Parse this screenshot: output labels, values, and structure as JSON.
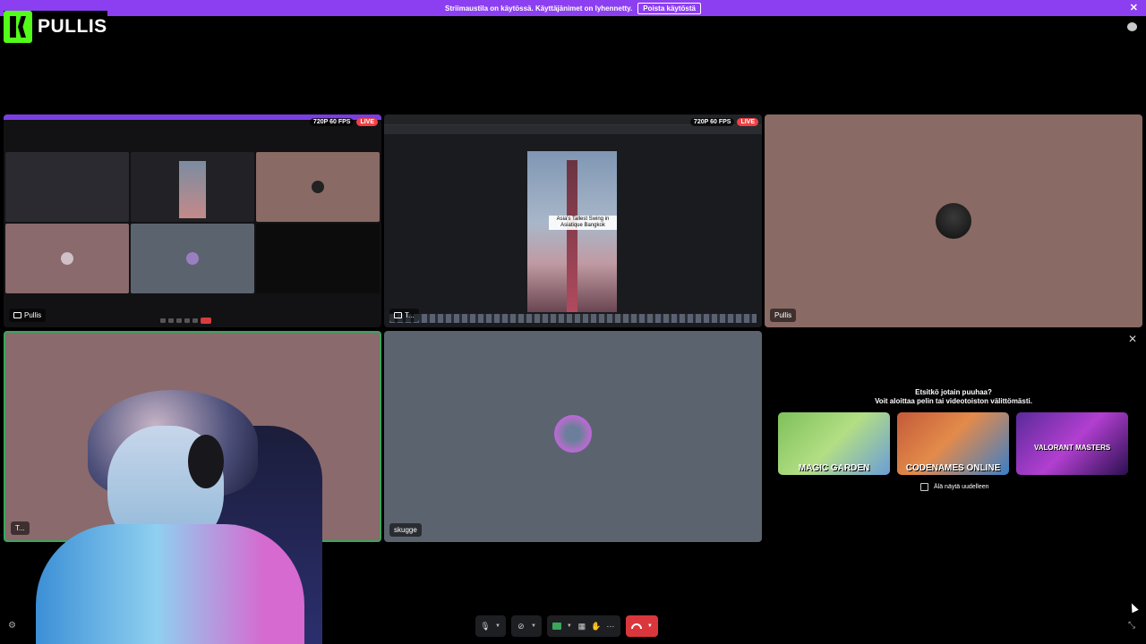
{
  "notice": {
    "text": "Striimaustila on käytössä. Käyttäjänimet on lyhennetty.",
    "button_label": "Poista käytöstä",
    "close_icon": "close-icon"
  },
  "brand": {
    "name": "PULLIS",
    "accent": "#53fc18"
  },
  "tiles": [
    {
      "name": "Pullis",
      "type": "screen-share",
      "resolution": "720P 60 FPS",
      "live": "LIVE"
    },
    {
      "name": "T...",
      "type": "screen-share",
      "resolution": "720P 60 FPS",
      "live": "LIVE",
      "video_caption": "Asia's Tallest Swing in Asiatique Bangkok"
    },
    {
      "name": "Pullis",
      "type": "camera-off"
    },
    {
      "name": "T...",
      "type": "camera"
    },
    {
      "name": "skugge",
      "type": "camera-off"
    }
  ],
  "activity": {
    "title_line1": "Etsitkö jotain puuhaa?",
    "title_line2": "Voit aloittaa pelin tai videotoiston välittömästi.",
    "cards": [
      {
        "label": "MAGIC GARDEN"
      },
      {
        "label": "CODENAMES ONLINE"
      },
      {
        "label": "VALORANT MASTERS"
      }
    ],
    "dont_show_label": "Älä näytä uudelleen"
  },
  "colors": {
    "banner": "#8c3ff0",
    "live": "#ed4245",
    "speaking": "#3ba55c",
    "end_call": "#da373c"
  }
}
